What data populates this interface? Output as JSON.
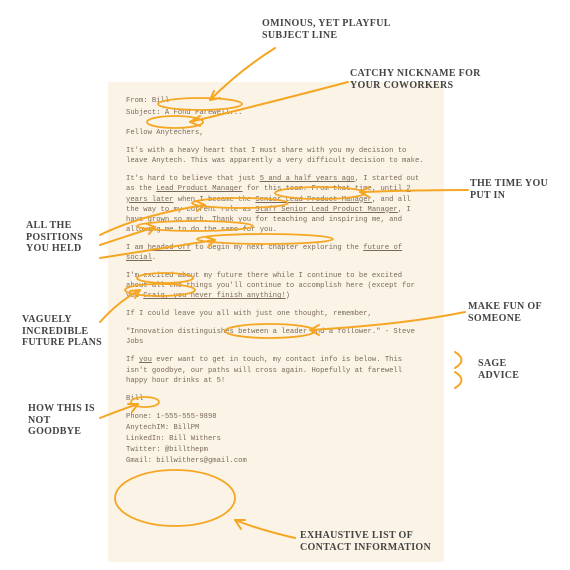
{
  "email": {
    "from_label": "From:",
    "from_value": "Bill",
    "subject_label": "Subject:",
    "subject_value": "A Fond Farewell...",
    "greeting_prefix": "Fellow ",
    "greeting_name": "Anytechers",
    "greeting_suffix": ",",
    "p1": "It's with a heavy heart that I must share with you my decision to leave Anytech. This was apparently a very difficult decision to make.",
    "p2a": "It's hard to believe that just ",
    "p2_time": "5 and a half years ago",
    "p2b": ", I started out as the ",
    "p2_role1": "Lead Product Manager",
    "p2c": " for this team. From that time, until ",
    "p2_time2": "2 years later",
    "p2d": " when I became the ",
    "p2_role2": "Senior Lead Product Manager",
    "p2e": ", and all the way to my current role as ",
    "p2_role3": "Staff Senior Lead Product Manager",
    "p2f": ", I have grown so much. Thank you for teaching and inspiring me, and allowing me to do the same for you.",
    "p3a": "I am ",
    "p3_headed": "headed off",
    "p3b": " to begin my next chapter exploring the ",
    "p3_future": "future of social",
    "p3c": ".",
    "p4a": "I'm excited about my future there while I continue to be excited about all the things you'll continue to accomplish here (except for you ",
    "p4_craig": "Craig, you never finish anything!",
    "p4b": ")",
    "p5": "If I could leave you all with just one thought, remember,",
    "quote": "\"Innovation distinguishes between a leader and a follower.\" - Steve Jobs",
    "p6a": "If ",
    "p6_you": "you",
    "p6b": " ever want to get in touch, my contact info is below. This isn't goodbye, our paths will cross again. Hopefully at farewell happy hour drinks at 5!",
    "signoff": "Bill",
    "contact": {
      "phone": "Phone: 1-555-555-9898",
      "im": "AnytechIM: BillPM",
      "linkedin": "LinkedIn: Bill Withers",
      "twitter": "Twitter: @billthepm",
      "gmail": "Gmail: billwithers@gmail.com"
    }
  },
  "annotations": {
    "subject": "Ominous, yet playful subject line",
    "nickname": "Catchy nickname for your coworkers",
    "time": "The time you put in",
    "positions": "All the positions you held",
    "future": "Vaguely incredible future plans",
    "makefun": "Make fun of someone",
    "sage": "Sage advice",
    "notgoodbye": "How this is not goodbye",
    "contact": "Exhaustive list of contact information"
  }
}
